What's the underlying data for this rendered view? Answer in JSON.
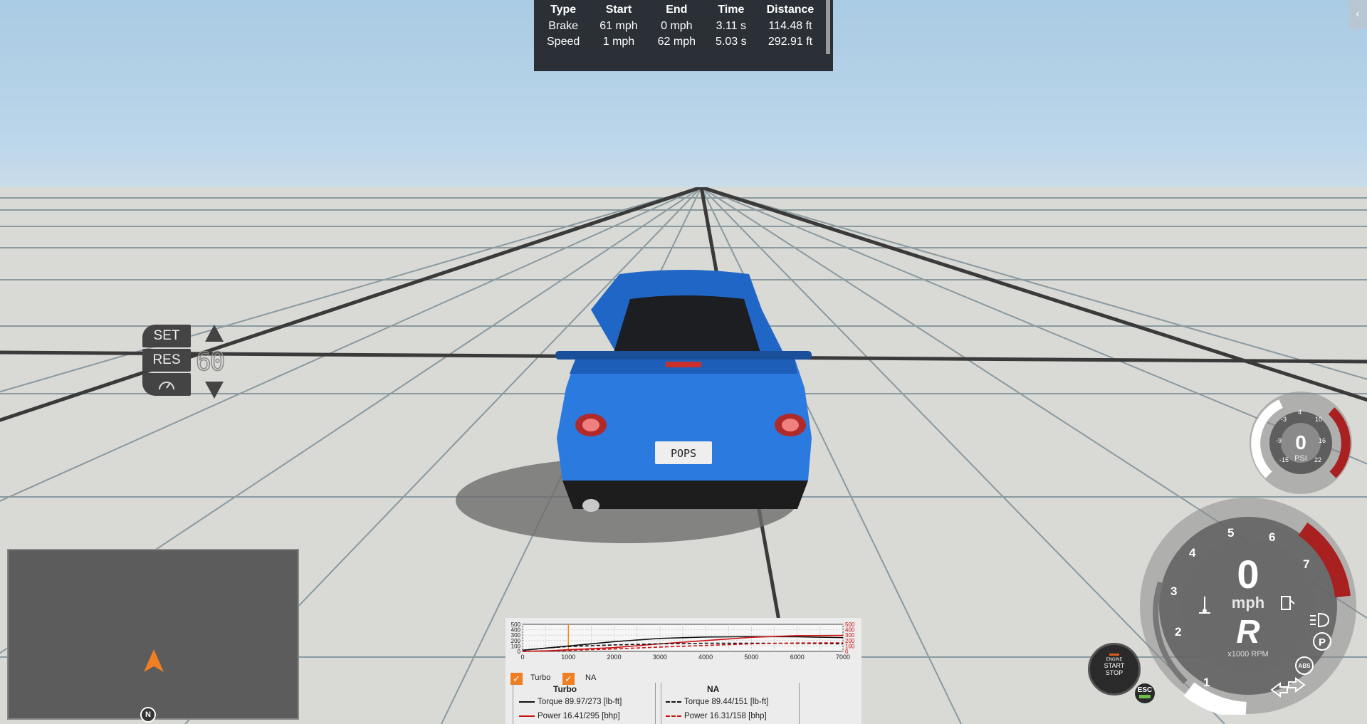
{
  "results": {
    "headers": [
      "Type",
      "Start",
      "End",
      "Time",
      "Distance"
    ],
    "rows": [
      [
        "Brake",
        "61 mph",
        "0 mph",
        "3.11 s",
        "114.48 ft"
      ],
      [
        "Speed",
        "1 mph",
        "62 mph",
        "5.03 s",
        "292.91 ft"
      ]
    ]
  },
  "collapse_icon": "‹",
  "cruise": {
    "set_label": "SET",
    "res_label": "RES",
    "speed": "60",
    "speedometer_icon": "cruise-gauge-icon"
  },
  "license_plate": "POPS",
  "minimap": {
    "north_label": "N"
  },
  "boost_gauge": {
    "value": "0",
    "unit": "PSI",
    "ticks": [
      "-15",
      "-9",
      "-3",
      "4",
      "10",
      "16",
      "22"
    ]
  },
  "main_gauge": {
    "speed": "0",
    "unit": "mph",
    "gear": "R",
    "rpm_label": "x1000 RPM",
    "rpm_ticks": [
      "1",
      "2",
      "3",
      "4",
      "5",
      "6",
      "7"
    ],
    "parking_label": "P",
    "abs_label": "ABS"
  },
  "engine_button": {
    "line1": "ENGINE",
    "line2": "START",
    "line3": "STOP"
  },
  "esc_label": "ESC",
  "torque_graph": {
    "y_ticks": [
      "500",
      "400",
      "300",
      "200",
      "100",
      "0"
    ],
    "x_ticks": [
      "0",
      "1000",
      "2000",
      "3000",
      "4000",
      "5000",
      "6000",
      "7000"
    ],
    "checkbox_turbo": "Turbo",
    "checkbox_na": "NA",
    "col_turbo": "Turbo",
    "col_na": "NA",
    "turbo_torque": "Torque 89.97/273 [lb-ft]",
    "turbo_power": "Power  16.41/295 [bhp]",
    "na_torque": "Torque 89.44/151 [lb-ft]",
    "na_power": "Power  16.31/158 [bhp]",
    "colors": {
      "torque": "#111111",
      "power": "#cc1111",
      "cursor": "#f08a20"
    }
  },
  "chart_data": {
    "type": "line",
    "x_label": "",
    "xlim": [
      0,
      7000
    ],
    "ylim": [
      0,
      500
    ],
    "series": [
      {
        "name": "Turbo Torque",
        "x": [
          0,
          500,
          1000,
          2000,
          3000,
          4000,
          5000,
          6000,
          7000
        ],
        "values": [
          20,
          60,
          100,
          180,
          240,
          265,
          273,
          270,
          255
        ]
      },
      {
        "name": "Turbo Power",
        "x": [
          0,
          500,
          1000,
          2000,
          3000,
          4000,
          5000,
          6000,
          7000
        ],
        "values": [
          0,
          10,
          30,
          70,
          140,
          200,
          260,
          290,
          295
        ]
      },
      {
        "name": "NA Torque",
        "x": [
          0,
          500,
          1000,
          2000,
          3000,
          4000,
          5000,
          6000,
          7000
        ],
        "values": [
          20,
          60,
          90,
          120,
          140,
          150,
          151,
          148,
          140
        ]
      },
      {
        "name": "NA Power",
        "x": [
          0,
          500,
          1000,
          2000,
          3000,
          4000,
          5000,
          6000,
          7000
        ],
        "values": [
          0,
          8,
          20,
          45,
          80,
          110,
          140,
          155,
          158
        ]
      }
    ],
    "cursor_x": 1000
  }
}
